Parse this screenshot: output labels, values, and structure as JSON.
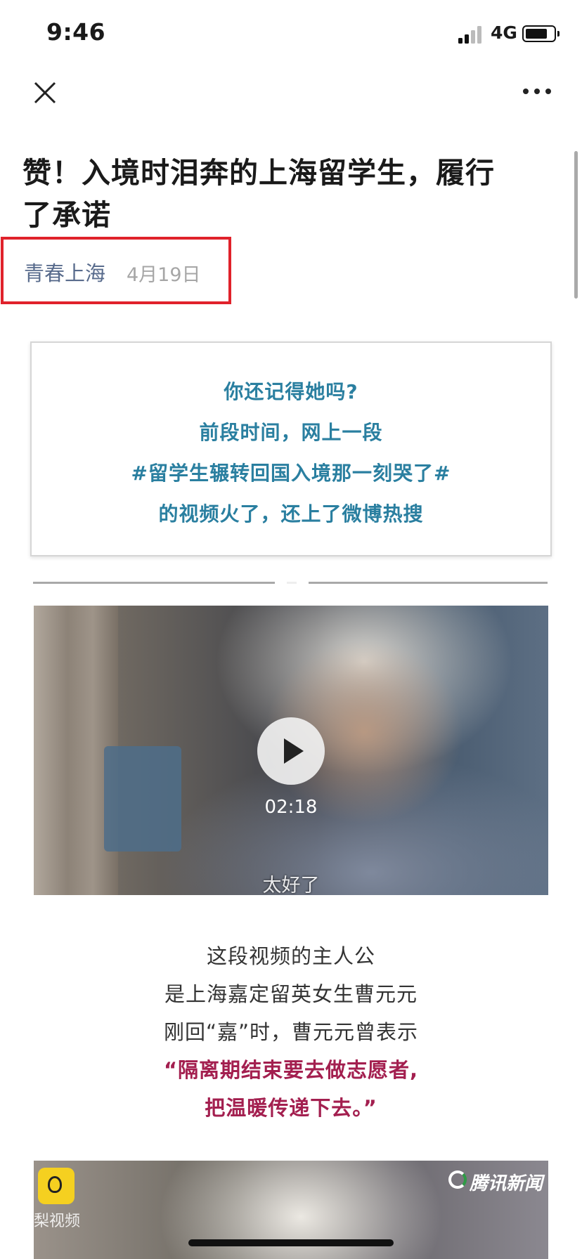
{
  "status_bar": {
    "time": "9:46",
    "network": "4G"
  },
  "nav": {
    "close_icon": "close-icon",
    "more_icon": "more-icon"
  },
  "article": {
    "title_line1": "赞！入境时泪奔的上海留学生，履行",
    "title_line2": "了承诺",
    "author": "青春上海",
    "date": "4月19日"
  },
  "quote_box": {
    "lines": [
      "你还记得她吗?",
      "前段时间，网上一段",
      "#留学生辗转回国入境那一刻哭了#",
      "的视频火了，还上了微博热搜"
    ]
  },
  "video": {
    "duration": "02:18",
    "subtitle": "太好了"
  },
  "paragraph": {
    "lines": [
      "这段视频的主人公",
      "是上海嘉定留英女生曹元元",
      "刚回“嘉”时，曹元元曾表示"
    ],
    "highlight_lines": [
      "“隔离期结束要去做志愿者,",
      "把温暖传递下去。”"
    ]
  },
  "video2": {
    "watermark_left": "梨视频",
    "watermark_right": "腾讯新闻"
  },
  "colors": {
    "highlight_box": "#e0222b",
    "quote_text": "#2a7fa0",
    "highlight_text": "#a31f4f"
  }
}
